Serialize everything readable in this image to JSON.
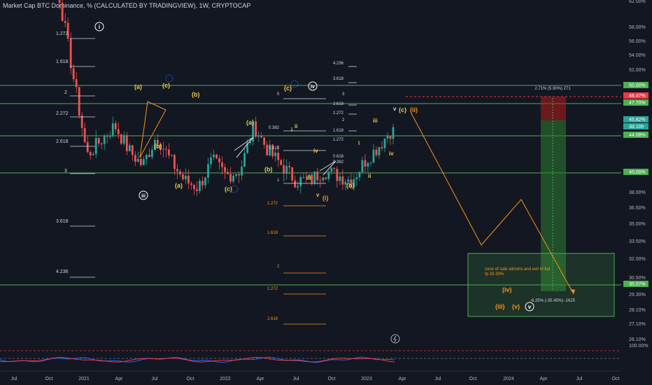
{
  "header": {
    "symbol": "Market Cap BTC Dominance, % (CALCULATED BY TRADINGVIEW), 1W, CRYPTOCAP"
  },
  "colors": {
    "background": "#131722",
    "up": "#26a69a",
    "down": "#ef5350",
    "level_line": "#4caf50",
    "fib_white": "#d1d4dc",
    "fib_orange": "#f7931a",
    "wave_yellow": "#e6c84a",
    "wave_orange": "#f7931a",
    "projection": "#f7931a",
    "target_box": "#4caf50",
    "long_green": "#2e7d32",
    "long_red": "#b71c1c",
    "current_label": "#26a69a",
    "price_red": "#f23645"
  },
  "chart_data": {
    "type": "candlestick",
    "title": "Market Cap BTC Dominance, % (CALCULATED BY TRADINGVIEW), 1W, CRYPTOCAP",
    "x_axis": [
      "Jul",
      "Oct",
      "2021",
      "Apr",
      "Jul",
      "Oct",
      "2022",
      "Apr",
      "Jul",
      "Oct",
      "2023",
      "Apr",
      "Jul",
      "Oct",
      "2024",
      "Apr",
      "Jul",
      "Oct"
    ],
    "y_axis_ticks": [
      "62.00%",
      "58.00%",
      "56.00%",
      "54.00%",
      "52.00%",
      "48.47%",
      "47.70%",
      "45.82%",
      "3d 10h",
      "44.08%",
      "40.00%",
      "38.00%",
      "36.50%",
      "35.00%",
      "33.50%",
      "32.00%",
      "30.50%",
      "30.07%",
      "29.30%",
      "28.10%",
      "27.10%",
      "26.10%",
      "100.00%"
    ],
    "horizontal_levels": [
      50.0,
      47.7,
      44.08,
      40.0,
      30.07
    ],
    "current_price": 45.82,
    "countdown": "3d 10h",
    "long_target": 48.47,
    "weekly_series": [
      {
        "date": "2020-07",
        "close": 64.5
      },
      {
        "date": "2020-10",
        "close": 61.0
      },
      {
        "date": "2021-01",
        "close": 65.0
      },
      {
        "date": "2021-02",
        "close": 61.5
      },
      {
        "date": "2021-03",
        "close": 59.0
      },
      {
        "date": "2021-04",
        "close": 51.0
      },
      {
        "date": "2021-05",
        "close": 43.0
      },
      {
        "date": "2021-06",
        "close": 44.5
      },
      {
        "date": "2021-07",
        "close": 46.0
      },
      {
        "date": "2021-08",
        "close": 43.5
      },
      {
        "date": "2021-09",
        "close": 42.0
      },
      {
        "date": "2021-10",
        "close": 45.0
      },
      {
        "date": "2021-11",
        "close": 42.5
      },
      {
        "date": "2021-12",
        "close": 40.5
      },
      {
        "date": "2022-01",
        "close": 39.8
      },
      {
        "date": "2022-02",
        "close": 42.5
      },
      {
        "date": "2022-03",
        "close": 41.0
      },
      {
        "date": "2022-04",
        "close": 41.5
      },
      {
        "date": "2022-05",
        "close": 46.0
      },
      {
        "date": "2022-06",
        "close": 43.5
      },
      {
        "date": "2022-07",
        "close": 42.0
      },
      {
        "date": "2022-08",
        "close": 40.5
      },
      {
        "date": "2022-09",
        "close": 40.5
      },
      {
        "date": "2022-10",
        "close": 41.5
      },
      {
        "date": "2022-11",
        "close": 41.0
      },
      {
        "date": "2022-12",
        "close": 40.5
      },
      {
        "date": "2023-01",
        "close": 42.5
      },
      {
        "date": "2023-02",
        "close": 44.0
      },
      {
        "date": "2023-03",
        "close": 45.82
      }
    ],
    "fib_levels_left": [
      "1.272",
      "1.618",
      "2",
      "2.272",
      "2.618",
      "3",
      "3.618",
      "4.236"
    ],
    "fib_levels_mid_orange": [
      "1.272",
      "1.618",
      "2",
      "2.272",
      "2.618"
    ],
    "fib_levels_mid_white": [
      "0",
      "0.382",
      "0.618",
      "1"
    ],
    "fib_levels_right": [
      "4.236",
      "3.618",
      "3",
      "2.618",
      "2.272",
      "2",
      "1.618",
      "1.272",
      "0.618",
      "0.382"
    ],
    "wave_labels": [
      "(a)",
      "(c)",
      "(b)",
      "(a)",
      "(c)",
      "(b)",
      "(a)",
      "(b)",
      "(c)",
      "(c)",
      "(b)",
      "(i)",
      "(ii)",
      "(iii)",
      "(iv)",
      "(v)",
      "i",
      "ii",
      "iii",
      "iv",
      "v",
      "i",
      "ii",
      "iii",
      "iv",
      "v"
    ],
    "wave_circled": [
      "i",
      "iii",
      "iv",
      "v"
    ],
    "long_position_label": "2.71% (5.90%) 271",
    "projection_label": "-6.25% (-35.45%) -1625",
    "note": "zone of sale altcoins and exit to fiat\ntp 33-30%"
  },
  "annotations": {
    "fib_left": [
      "1.272",
      "1.618",
      "2",
      "2.272",
      "2.618",
      "3",
      "3.618",
      "4.236"
    ],
    "fib_mid_white": [
      "0",
      "0.382",
      "0.618",
      "1"
    ],
    "fib_mid_orange": [
      "1.272",
      "1.618",
      "2",
      "2.272",
      "2.618"
    ],
    "fib_right": [
      "4.236",
      "3.618",
      "3",
      "2.618",
      "2.272",
      "2",
      "1.618",
      "1.272",
      "0.618",
      "0.382"
    ],
    "wave_a1": "(a)",
    "wave_c1": "(c)",
    "wave_b1": "(b)",
    "wave_b2": "(b)",
    "wave_a2": "(a)",
    "wave_c2": "(c)",
    "wave_a3": "(a)",
    "wave_b3": "(b)",
    "wave_c3": "(c)",
    "wave_b4": "(b)",
    "wave_c4": "(c)",
    "wave_ii": "(ii)",
    "wave_i_paren": "(i)",
    "wave_iii_paren": "(iii)",
    "wave_iv_paren": "(iv)",
    "wave_v_paren": "(v)",
    "small_i1": "i",
    "small_ii1": "ii",
    "small_iii1": "iii",
    "small_iv1": "iv",
    "small_v1": "v",
    "small_i2": "i",
    "small_ii2": "ii",
    "small_iii2": "iii",
    "small_iv2": "iv",
    "small_v2": "v",
    "circ_i": "i",
    "circ_iii": "iii",
    "circ_iv": "iv",
    "circ_v": "v",
    "long_label": "2.71% (5.90%) 271",
    "proj_label": "-6.25% (-35.45%) -1625",
    "note_line1": "zone of sale altcoins and exit to fiat",
    "note_line2": "tp 33-30%"
  }
}
